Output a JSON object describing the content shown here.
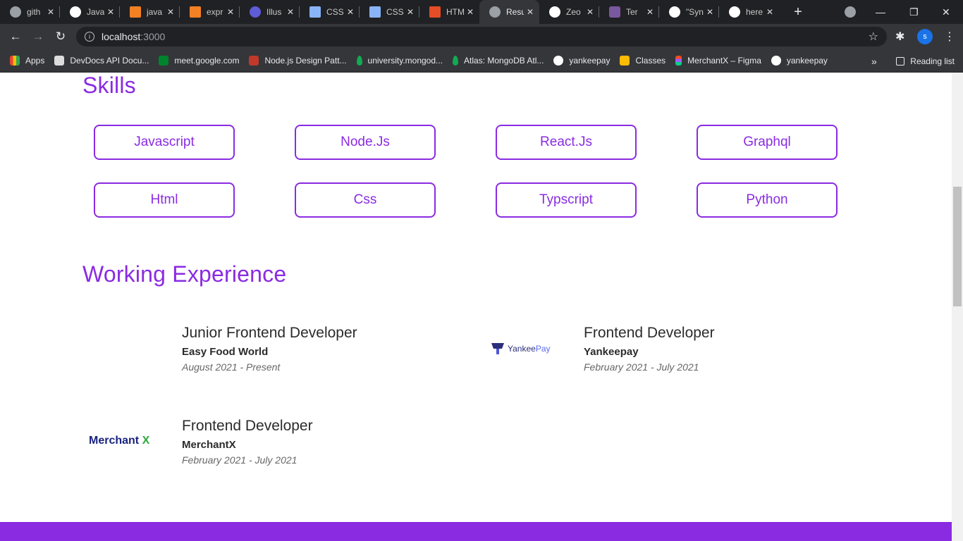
{
  "browser": {
    "tabs": [
      {
        "title": "gith",
        "icon": "globe-icon"
      },
      {
        "title": "Java",
        "icon": "github-icon"
      },
      {
        "title": "java",
        "icon": "stackoverflow-icon"
      },
      {
        "title": "expr",
        "icon": "stackoverflow-icon"
      },
      {
        "title": "Illus",
        "icon": "app-icon"
      },
      {
        "title": "CSS",
        "icon": "doc-icon"
      },
      {
        "title": "CSS",
        "icon": "doc-icon"
      },
      {
        "title": "HTM",
        "icon": "html-icon"
      },
      {
        "title": "Resu",
        "icon": "globe-icon"
      },
      {
        "title": "Zeo",
        "icon": "github-icon"
      },
      {
        "title": "Ter",
        "icon": "h-icon"
      },
      {
        "title": "\"Syn",
        "icon": "github-icon"
      },
      {
        "title": "here",
        "icon": "google-icon"
      }
    ],
    "url_host": "localhost",
    "url_port": ":3000",
    "profile_initial": "s",
    "bookmarks": [
      {
        "label": "Apps"
      },
      {
        "label": "DevDocs API Docu..."
      },
      {
        "label": "meet.google.com"
      },
      {
        "label": "Node.js Design Patt..."
      },
      {
        "label": "university.mongod..."
      },
      {
        "label": "Atlas: MongoDB Atl..."
      },
      {
        "label": "yankeepay"
      },
      {
        "label": "Classes"
      },
      {
        "label": "MerchantX – Figma"
      },
      {
        "label": "yankeepay"
      }
    ],
    "bookmarks_more": "»",
    "reading_list": "Reading list"
  },
  "skills": {
    "heading": "Skills",
    "items": [
      "Javascript",
      "Node.Js",
      "React.Js",
      "Graphql",
      "Html",
      "Css",
      "Typscript",
      "Python"
    ]
  },
  "experience": {
    "heading": "Working Experience",
    "jobs": [
      {
        "role": "Junior Frontend Developer",
        "company": "Easy Food World",
        "dates": "August 2021 - Present"
      },
      {
        "role": "Frontend Developer",
        "company": "Yankeepay",
        "dates": "February 2021 - July 2021"
      },
      {
        "role": "Frontend Developer",
        "company": "MerchantX",
        "dates": "February 2021 - July 2021"
      }
    ],
    "logos": {
      "yankee_a": "Yankee",
      "yankee_b": "Pay",
      "merchant_a": "Merchant",
      "merchant_b": "X"
    }
  },
  "colors": {
    "accent": "#8a2be2"
  }
}
